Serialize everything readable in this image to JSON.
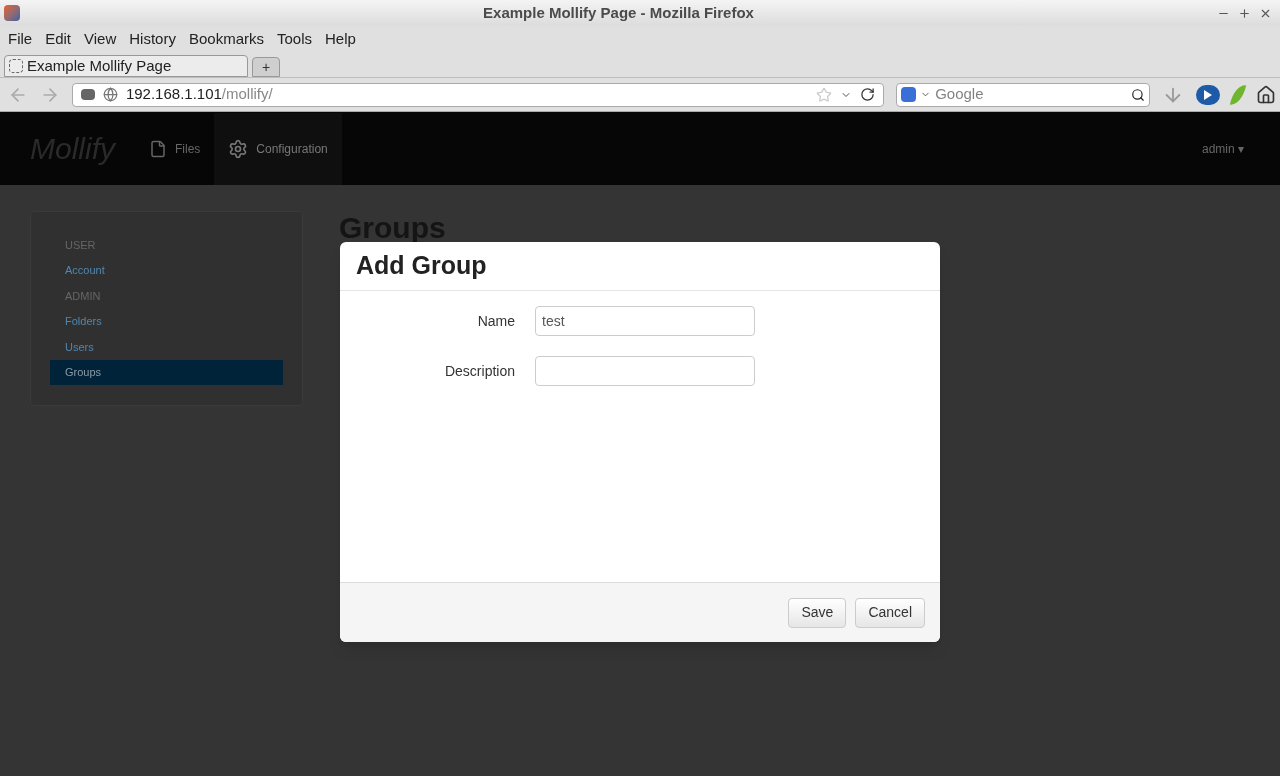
{
  "window": {
    "title": "Example Mollify Page - Mozilla Firefox"
  },
  "menu": [
    "File",
    "Edit",
    "View",
    "History",
    "Bookmarks",
    "Tools",
    "Help"
  ],
  "tabs": [
    {
      "label": "Example Mollify Page",
      "selected": true
    }
  ],
  "new_tab": "+",
  "address": {
    "host": "192.168.1.101",
    "path": "/mollify/"
  },
  "search": {
    "placeholder": "Google"
  },
  "app": {
    "logo": "Mollify",
    "nav": [
      {
        "label": "Files",
        "selected": false
      },
      {
        "label": "Configuration",
        "selected": true
      }
    ],
    "user_menu": "admin",
    "user_caret": "▾"
  },
  "sidebar": [
    {
      "kind": "header",
      "label": "USER"
    },
    {
      "kind": "link",
      "label": "Account",
      "selected": false
    },
    {
      "kind": "header",
      "label": "ADMIN"
    },
    {
      "kind": "link",
      "label": "Folders",
      "selected": false
    },
    {
      "kind": "link",
      "label": "Users",
      "selected": false
    },
    {
      "kind": "link",
      "label": "Groups",
      "selected": true
    }
  ],
  "page_title": "Groups",
  "dialog": {
    "title": "Add Group",
    "fields": [
      {
        "label": "Name",
        "value": "test"
      },
      {
        "label": "Description"
      }
    ],
    "buttons": [
      "Save",
      "Cancel"
    ]
  }
}
